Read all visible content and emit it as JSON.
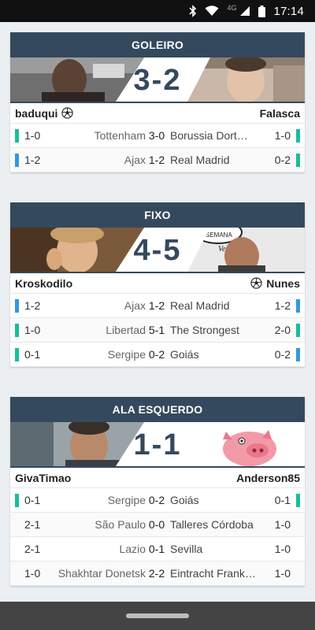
{
  "status": {
    "network": "4G",
    "time": "17:14"
  },
  "colors": {
    "header": "#34495e",
    "bar_green": "#1abc9c",
    "bar_blue": "#3498db"
  },
  "cards": [
    {
      "title": "GOLEIRO",
      "score": "3-2",
      "left_player": "baduqui",
      "right_player": "Falasca",
      "ball_side": "left",
      "matches": [
        {
          "left_pred": "1-0",
          "home": "Tottenham",
          "result": "3-0",
          "away": "Borussia Dortmund",
          "right_pred": "1-0",
          "left_color": "green",
          "right_color": "green"
        },
        {
          "left_pred": "1-2",
          "home": "Ajax",
          "result": "1-2",
          "away": "Real Madrid",
          "right_pred": "0-2",
          "left_color": "blue",
          "right_color": "green"
        }
      ]
    },
    {
      "title": "FIXO",
      "score": "4-5",
      "left_player": "Kroskodilo",
      "right_player": "Nunes",
      "ball_side": "right",
      "matches": [
        {
          "left_pred": "1-2",
          "home": "Ajax",
          "result": "1-2",
          "away": "Real Madrid",
          "right_pred": "1-2",
          "left_color": "blue",
          "right_color": "blue"
        },
        {
          "left_pred": "1-0",
          "home": "Libertad",
          "result": "5-1",
          "away": "The Strongest",
          "right_pred": "2-0",
          "left_color": "green",
          "right_color": "green"
        },
        {
          "left_pred": "0-1",
          "home": "Sergipe",
          "result": "0-2",
          "away": "Goiás",
          "right_pred": "0-2",
          "left_color": "green",
          "right_color": "blue"
        }
      ]
    },
    {
      "title": "ALA ESQUERDO",
      "score": "1-1",
      "left_player": "GivaTimao",
      "right_player": "Anderson85",
      "ball_side": "none",
      "matches": [
        {
          "left_pred": "0-1",
          "home": "Sergipe",
          "result": "0-2",
          "away": "Goiás",
          "right_pred": "0-1",
          "left_color": "green",
          "right_color": "green"
        },
        {
          "left_pred": "2-1",
          "home": "São Paulo",
          "result": "0-0",
          "away": "Talleres Córdoba",
          "right_pred": "1-0",
          "left_color": "none",
          "right_color": "none"
        },
        {
          "left_pred": "2-1",
          "home": "Lazio",
          "result": "0-1",
          "away": "Sevilla",
          "right_pred": "1-0",
          "left_color": "none",
          "right_color": "none"
        },
        {
          "left_pred": "1-0",
          "home": "Shakhtar Donetsk",
          "result": "2-2",
          "away": "Eintracht Frankfurt",
          "right_pred": "1-0",
          "left_color": "none",
          "right_color": "none"
        }
      ]
    }
  ]
}
